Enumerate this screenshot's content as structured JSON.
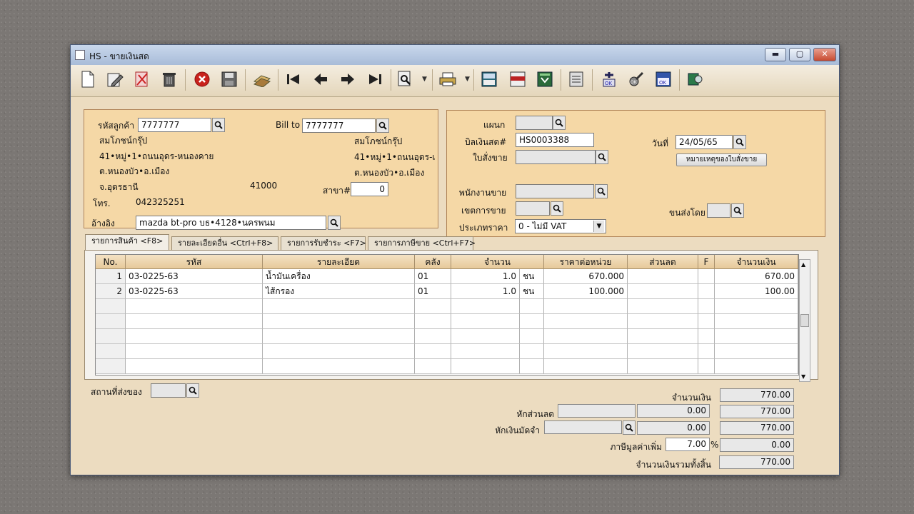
{
  "window": {
    "title": "HS - ขายเงินสด"
  },
  "customer": {
    "code_label": "รหัสลูกค้า",
    "code": "7777777",
    "name": "สมโภชน์กรุ๊ป",
    "addr1": "41•หมู่•1•ถนนอุดร-หนองคาย",
    "addr2": "ต.หนองบัว•อ.เมือง",
    "province": "จ.อุดรธานี",
    "postcode": "41000",
    "phone_label": "โทร.",
    "phone": "042325251",
    "ref_label": "อ้างอิง",
    "ref": "mazda bt-pro บธ•4128•นครพนม"
  },
  "billto": {
    "label": "Bill to",
    "code": "7777777",
    "name": "สมโภชน์กรุ๊ป",
    "addr1": "41•หมู่•1•ถนนอุดร-เ",
    "addr2": "ต.หนองบัว•อ.เมือง",
    "branch_label": "สาขา#",
    "branch": "0"
  },
  "doc": {
    "dept_label": "แผนก",
    "dept": "",
    "invoice_label": "บิลเงินสด#",
    "invoice": "HS0003388",
    "order_label": "ใบสั่งขาย",
    "order": "",
    "date_label": "วันที่",
    "date": "24/05/65",
    "order_note_button": "หมายเหตุของใบสั่งขาย",
    "salesman_label": "พนักงานขาย",
    "salesman": "",
    "area_label": "เขตการขาย",
    "area": "",
    "shipby_label": "ขนส่งโดย",
    "shipby": "",
    "pricetype_label": "ประเภทราคา",
    "pricetype": "0 - ไม่มี VAT"
  },
  "tabs": [
    {
      "label": "รายการสินค้า <F8>"
    },
    {
      "label": "รายละเอียดอื่น <Ctrl+F8>"
    },
    {
      "label": "รายการรับชำระ <F7>"
    },
    {
      "label": "รายการภาษีขาย <Ctrl+F7>"
    }
  ],
  "grid": {
    "headers": [
      "No.",
      "รหัส",
      "รายละเอียด",
      "คลัง",
      "จำนวน",
      "ราคาต่อหน่วย",
      "ส่วนลด",
      "F",
      "จำนวนเงิน"
    ],
    "rows": [
      {
        "no": "1",
        "code": "03-0225-63",
        "desc": "น้ำมันเครื่อง",
        "wh": "01",
        "qty": "1.0",
        "unit": "ชน",
        "price": "670.000",
        "disc": "",
        "f": "",
        "amount": "670.00"
      },
      {
        "no": "2",
        "code": "03-0225-63",
        "desc": "ไส้กรอง",
        "wh": "01",
        "qty": "1.0",
        "unit": "ชน",
        "price": "100.000",
        "disc": "",
        "f": "",
        "amount": "100.00"
      }
    ]
  },
  "shipto": {
    "label": "สถานที่ส่งของ",
    "value": ""
  },
  "summary": {
    "amount_label": "จำนวนเงิน",
    "amount": "770.00",
    "discount_label": "หักส่วนลด",
    "discount_text": "",
    "discount_value": "0.00",
    "after_discount": "770.00",
    "deposit_label": "หักเงินมัดจำ",
    "deposit_text": "",
    "deposit_value": "0.00",
    "after_deposit": "770.00",
    "vat_label": "ภาษีมูลค่าเพิ่ม",
    "vat_rate": "7.00",
    "vat_pct": "%",
    "vat_amount": "0.00",
    "total_label": "จำนวนเงินรวมทั้งสิ้น",
    "total": "770.00"
  }
}
